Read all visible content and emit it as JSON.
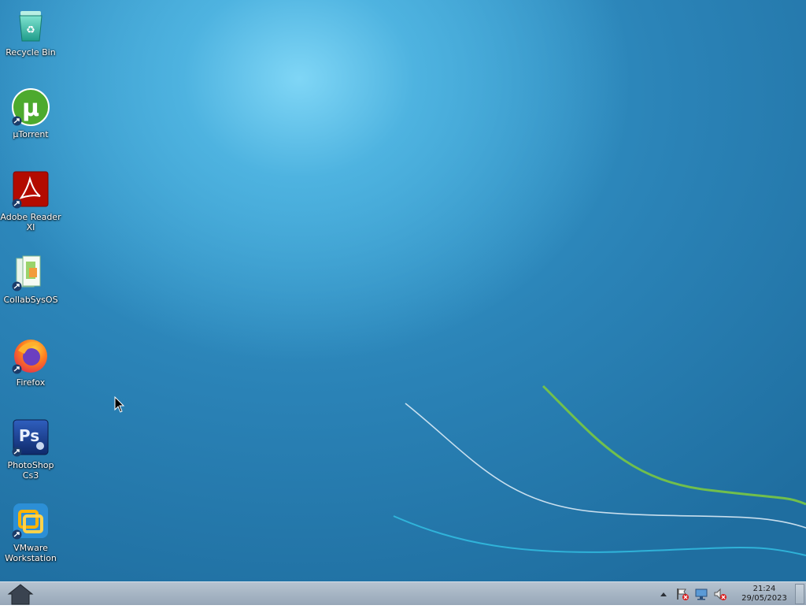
{
  "desktop": {
    "icons": [
      {
        "label": "Recycle Bin",
        "icon": "recycle-bin-icon"
      },
      {
        "label": "µTorrent",
        "icon": "utorrent-icon"
      },
      {
        "label": "Adobe Reader XI",
        "icon": "adobe-reader-icon"
      },
      {
        "label": "CollabSysOS",
        "icon": "collabsysos-icon"
      },
      {
        "label": "Firefox",
        "icon": "firefox-icon"
      },
      {
        "label": "PhotoShop Cs3",
        "icon": "photoshop-icon"
      },
      {
        "label": "VMware Workstation",
        "icon": "vmware-icon"
      }
    ]
  },
  "taskbar": {
    "start_icon": "home-icon",
    "tray_icons": [
      "tray-expand-icon",
      "action-center-flag-icon",
      "network-icon",
      "volume-muted-icon"
    ],
    "clock": {
      "time": "21:24",
      "date": "29/05/2023"
    }
  },
  "colors": {
    "desktop_bg": "#1f6ea0",
    "taskbar_bg": "#a7b6c6",
    "swoosh_green": "#7ac843",
    "swoosh_white": "#e6f2fa",
    "swoosh_cyan": "#33c3e6"
  }
}
